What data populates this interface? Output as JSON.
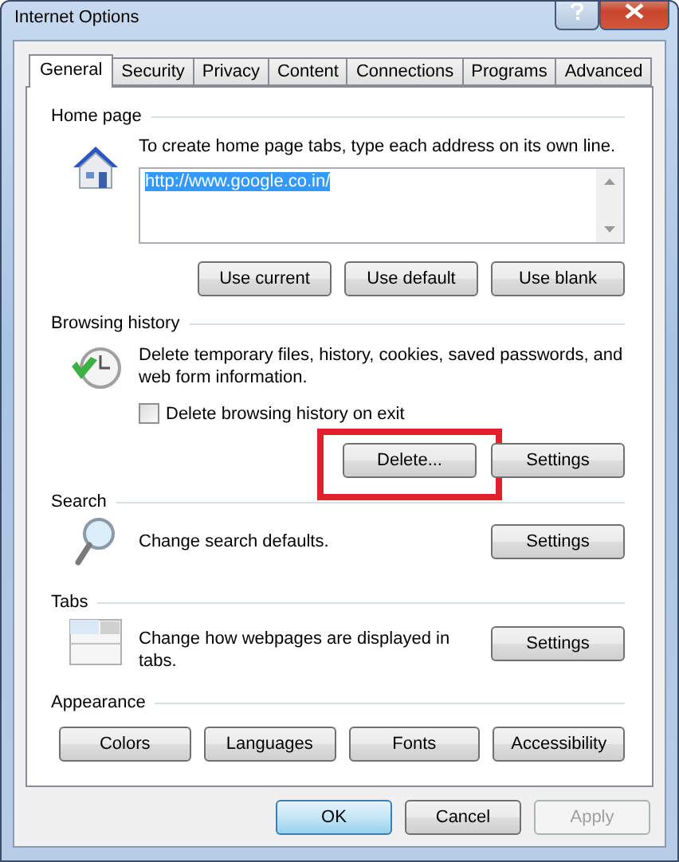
{
  "window": {
    "title": "Internet Options"
  },
  "tabs": [
    {
      "label": "General",
      "selected": true
    },
    {
      "label": "Security",
      "selected": false
    },
    {
      "label": "Privacy",
      "selected": false
    },
    {
      "label": "Content",
      "selected": false
    },
    {
      "label": "Connections",
      "selected": false
    },
    {
      "label": "Programs",
      "selected": false
    },
    {
      "label": "Advanced",
      "selected": false
    }
  ],
  "home_page": {
    "heading": "Home page",
    "description": "To create home page tabs, type each address on its own line.",
    "addresses": {
      "value": "http://www.google.co.in/",
      "selected": true
    },
    "buttons": [
      "Use current",
      "Use default",
      "Use blank"
    ]
  },
  "browsing_history": {
    "heading": "Browsing history",
    "description": "Delete temporary files, history, cookies, saved passwords, and web form information.",
    "checkbox": {
      "label": "Delete browsing history on exit",
      "checked": false
    },
    "buttons": [
      {
        "label": "Delete...",
        "highlighted": true
      },
      {
        "label": "Settings",
        "highlighted": false
      }
    ]
  },
  "search": {
    "heading": "Search",
    "description": "Change search defaults.",
    "button": "Settings"
  },
  "tabs_section": {
    "heading": "Tabs",
    "description": "Change how webpages are displayed in tabs.",
    "button": "Settings"
  },
  "appearance": {
    "heading": "Appearance",
    "buttons": [
      "Colors",
      "Languages",
      "Fonts",
      "Accessibility"
    ]
  },
  "footer_buttons": [
    {
      "label": "OK",
      "default": true,
      "disabled": false
    },
    {
      "label": "Cancel",
      "default": false,
      "disabled": false
    },
    {
      "label": "Apply",
      "default": false,
      "disabled": true
    }
  ]
}
